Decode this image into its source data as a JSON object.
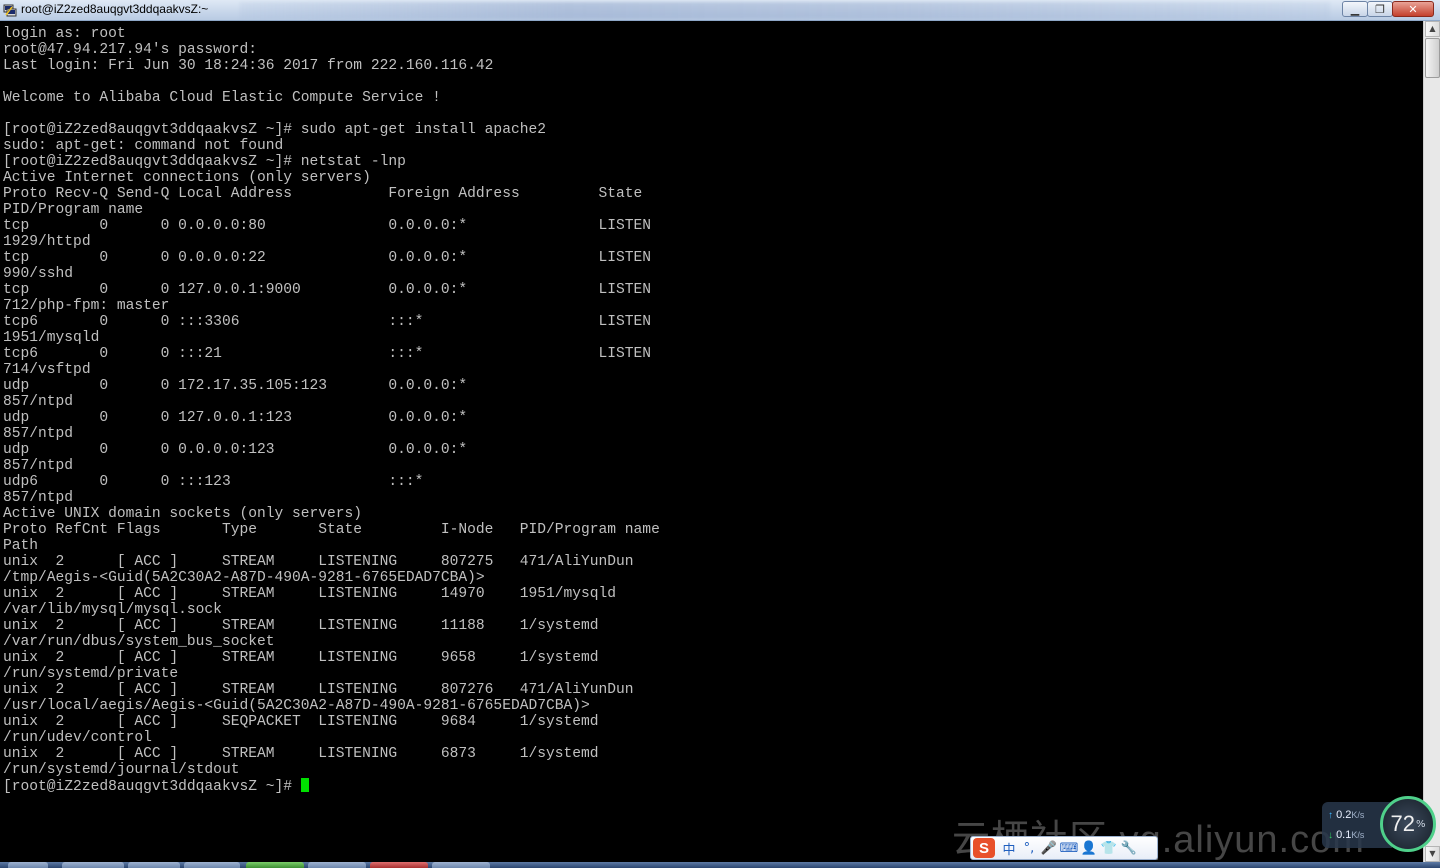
{
  "window": {
    "title": "root@iZ2zed8auqgvt3ddqaakvsZ:~",
    "minimize_glyph": "▁",
    "maximize_glyph": "❐",
    "close_glyph": "✕"
  },
  "terminal": {
    "lines": [
      "login as: root",
      "root@47.94.217.94's password:",
      "Last login: Fri Jun 30 18:24:36 2017 from 222.160.116.42",
      "",
      "Welcome to Alibaba Cloud Elastic Compute Service !",
      "",
      "[root@iZ2zed8auqgvt3ddqaakvsZ ~]# sudo apt-get install apache2",
      "sudo: apt-get: command not found",
      "[root@iZ2zed8auqgvt3ddqaakvsZ ~]# netstat -lnp",
      "Active Internet connections (only servers)",
      "Proto Recv-Q Send-Q Local Address           Foreign Address         State",
      "PID/Program name",
      "tcp        0      0 0.0.0.0:80              0.0.0.0:*               LISTEN",
      "1929/httpd",
      "tcp        0      0 0.0.0.0:22              0.0.0.0:*               LISTEN",
      "990/sshd",
      "tcp        0      0 127.0.0.1:9000          0.0.0.0:*               LISTEN",
      "712/php-fpm: master",
      "tcp6       0      0 :::3306                 :::*                    LISTEN",
      "1951/mysqld",
      "tcp6       0      0 :::21                   :::*                    LISTEN",
      "714/vsftpd",
      "udp        0      0 172.17.35.105:123       0.0.0.0:*",
      "857/ntpd",
      "udp        0      0 127.0.0.1:123           0.0.0.0:*",
      "857/ntpd",
      "udp        0      0 0.0.0.0:123             0.0.0.0:*",
      "857/ntpd",
      "udp6       0      0 :::123                  :::*",
      "857/ntpd",
      "Active UNIX domain sockets (only servers)",
      "Proto RefCnt Flags       Type       State         I-Node   PID/Program name",
      "Path",
      "unix  2      [ ACC ]     STREAM     LISTENING     807275   471/AliYunDun",
      "/tmp/Aegis-<Guid(5A2C30A2-A87D-490A-9281-6765EDAD7CBA)>",
      "unix  2      [ ACC ]     STREAM     LISTENING     14970    1951/mysqld",
      "/var/lib/mysql/mysql.sock",
      "unix  2      [ ACC ]     STREAM     LISTENING     11188    1/systemd",
      "/var/run/dbus/system_bus_socket",
      "unix  2      [ ACC ]     STREAM     LISTENING     9658     1/systemd",
      "/run/systemd/private",
      "unix  2      [ ACC ]     STREAM     LISTENING     807276   471/AliYunDun",
      "/usr/local/aegis/Aegis-<Guid(5A2C30A2-A87D-490A-9281-6765EDAD7CBA)>",
      "unix  2      [ ACC ]     SEQPACKET  LISTENING     9684     1/systemd",
      "/run/udev/control",
      "unix  2      [ ACC ]     STREAM     LISTENING     6873     1/systemd",
      "/run/systemd/journal/stdout"
    ],
    "prompt": "[root@iZ2zed8auqgvt3ddqaakvsZ ~]# "
  },
  "scrollbar": {
    "up_glyph": "▲",
    "down_glyph": "▼"
  },
  "watermark": {
    "text": "云栖社区 yq.aliyun.com"
  },
  "net_monitor": {
    "upload_value": "0.2",
    "upload_unit": "K/s",
    "download_value": "0.1",
    "download_unit": "K/s",
    "percent": "72",
    "percent_sign": "%",
    "up_arrow": "↑",
    "down_arrow": "↓"
  },
  "ime_toolbar": {
    "logo": "S",
    "items": [
      "中",
      "°,",
      "🎤",
      "⌨",
      "👤",
      "👕",
      "🔧"
    ]
  },
  "colors": {
    "terminal_bg": "#000000",
    "terminal_fg": "#c0c0c0",
    "cursor": "#00e000",
    "titlebar": "#c7d6ea"
  }
}
